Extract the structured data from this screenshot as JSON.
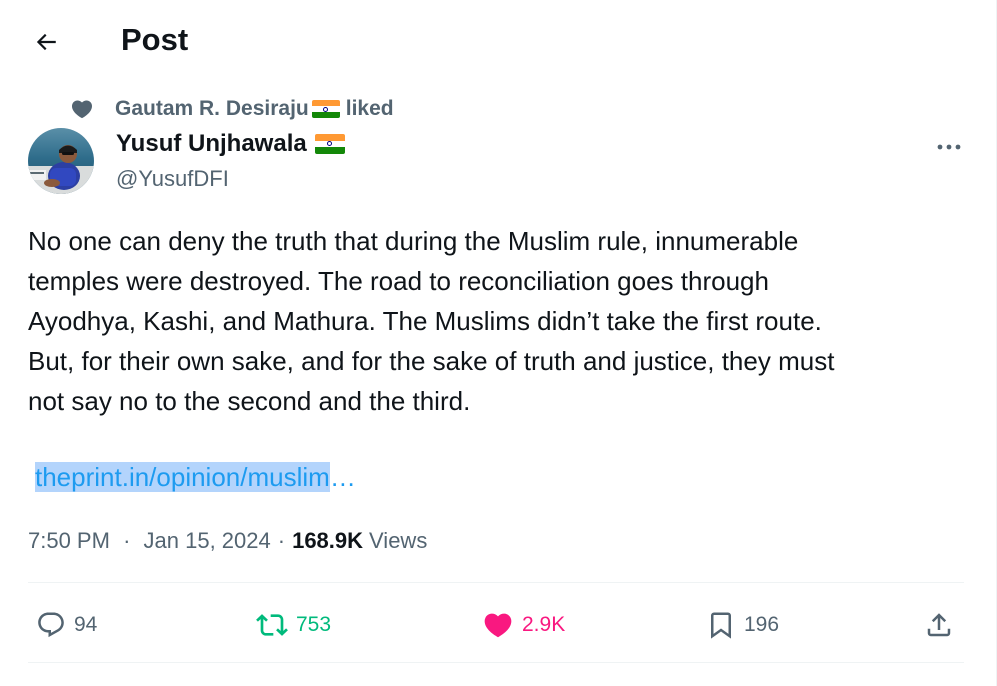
{
  "header": {
    "title": "Post",
    "back_icon": "arrow-left-icon"
  },
  "social_context": {
    "icon": "heart-icon",
    "user": "Gautam R. Desiraju",
    "flag": "india-flag",
    "action": "liked"
  },
  "author": {
    "name": "Yusuf Unjhawala",
    "flag": "india-flag",
    "handle": "@YusufDFI"
  },
  "tweet": {
    "lines": [
      "No one can deny the truth that during the Muslim rule, innumerable",
      "temples were destroyed. The road to reconciliation goes through",
      "Ayodhya, Kashi, and Mathura. The Muslims didn’t take the first route.",
      "But, for their own sake, and for the sake of truth and justice, they must",
      "not say no to the second and the third."
    ],
    "link": "theprint.in/opinion/muslim",
    "link_ellipsis": "…"
  },
  "meta": {
    "time": "7:50 PM",
    "separator": "·",
    "date": "Jan 15, 2024",
    "views_count": "168.9K",
    "views_label": "Views"
  },
  "actions": {
    "replies": "94",
    "reposts": "753",
    "likes": "2.9K",
    "bookmarks": "196"
  },
  "colors": {
    "text": "#0f1419",
    "secondary": "#536471",
    "link": "#1d9bf0",
    "repost": "#00ba7c",
    "like": "#f91880",
    "divider": "#eff3f4"
  }
}
